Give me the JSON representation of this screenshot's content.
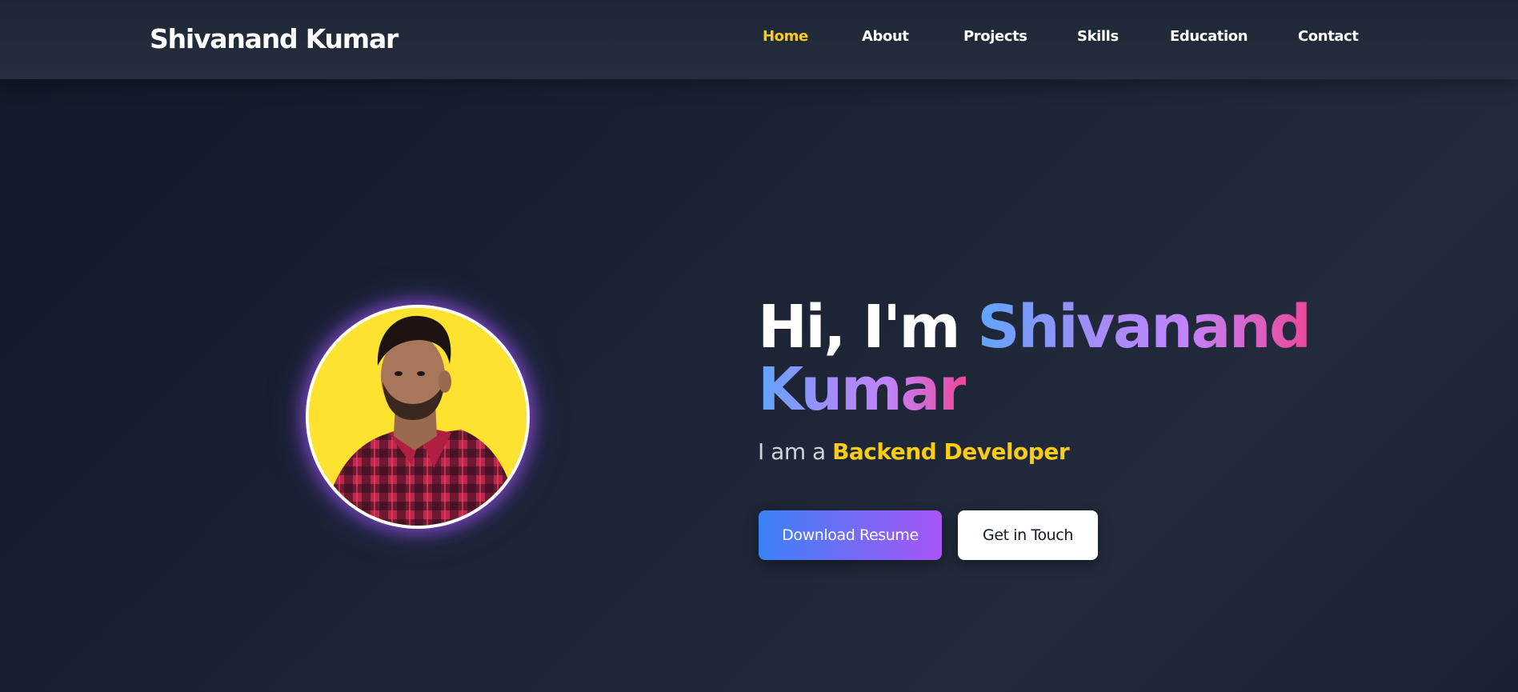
{
  "site": {
    "brand": "Shivanand Kumar"
  },
  "nav": {
    "items": [
      {
        "label": "Home",
        "active": true
      },
      {
        "label": "About",
        "active": false
      },
      {
        "label": "Projects",
        "active": false
      },
      {
        "label": "Skills",
        "active": false
      },
      {
        "label": "Education",
        "active": false
      },
      {
        "label": "Contact",
        "active": false
      }
    ]
  },
  "hero": {
    "greeting_prefix": "Hi, I'm ",
    "name": "Shivanand Kumar",
    "tagline_prefix": "I am a ",
    "role": "Backend Developer",
    "primary_button": "Download Resume",
    "secondary_button": "Get in Touch",
    "photo_description": "profile-photo"
  },
  "colors": {
    "accent_yellow": "#facc15",
    "gradient_start": "#3b82f6",
    "gradient_end": "#a855f7",
    "name_gradient": [
      "#60a5fa",
      "#a78bfa",
      "#c084fc",
      "#ec4899"
    ],
    "background": "#1b2334",
    "photo_background": "#fde22f"
  }
}
